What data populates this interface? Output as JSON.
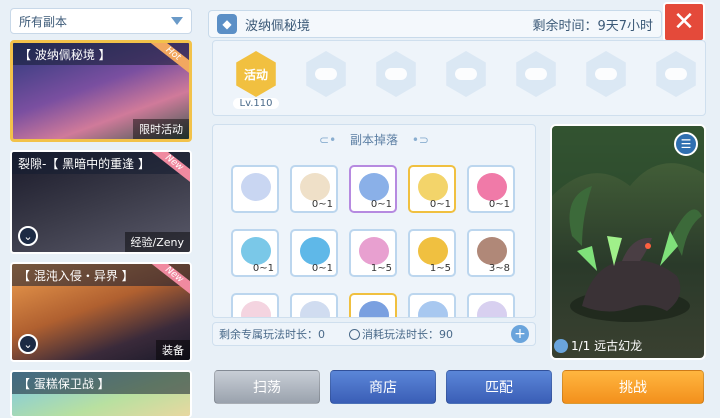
{
  "filter": {
    "label": "所有副本"
  },
  "sidebar": {
    "cards": [
      {
        "title": "【 波纳佩秘境 】",
        "tag": "限时活动",
        "badge": "Hot"
      },
      {
        "title": "裂隙-【 黑暗中的重逢 】",
        "tag": "经验/Zeny",
        "badge": "New"
      },
      {
        "title": "【 混沌入侵・异界 】",
        "tag": "装备",
        "badge": "New"
      },
      {
        "title": "【 蛋糕保卫战 】",
        "tag": "",
        "badge": ""
      }
    ]
  },
  "header": {
    "title": "波纳佩秘境",
    "time": "剩余时间：9天7小时"
  },
  "levels": {
    "active_label": "活动",
    "level_text": "Lv.110"
  },
  "drops": {
    "title": "副本掉落",
    "items": [
      {
        "qty": "",
        "color": "#c9d6f2"
      },
      {
        "qty": "0~1",
        "color": "#efe0c8"
      },
      {
        "qty": "0~1",
        "color": "#8ab0e8"
      },
      {
        "qty": "0~1",
        "color": "#f3d46a"
      },
      {
        "qty": "0~1",
        "color": "#f07aa8"
      },
      {
        "qty": "0~1",
        "color": "#7ac8e8"
      },
      {
        "qty": "0~1",
        "color": "#5fb8e8"
      },
      {
        "qty": "1~5",
        "color": "#e8a0d0"
      },
      {
        "qty": "1~5",
        "color": "#f0c040"
      },
      {
        "qty": "3~8",
        "color": "#b08878"
      },
      {
        "qty": "",
        "color": "#f4d4e0"
      },
      {
        "qty": "",
        "color": "#d0dcf0"
      },
      {
        "qty": "",
        "color": "#7aa0e0"
      },
      {
        "qty": "",
        "color": "#a8c8f0"
      },
      {
        "qty": "",
        "color": "#d8d0f0"
      }
    ]
  },
  "remain": {
    "exclusive": "剩余专属玩法时长：0",
    "consume": "消耗玩法时长：90",
    "plus": "+"
  },
  "boss": {
    "name": "1/1 远古幻龙"
  },
  "buttons": {
    "sweep": "扫荡",
    "shop": "商店",
    "match": "匹配",
    "challenge": "挑战"
  },
  "close": "✕"
}
